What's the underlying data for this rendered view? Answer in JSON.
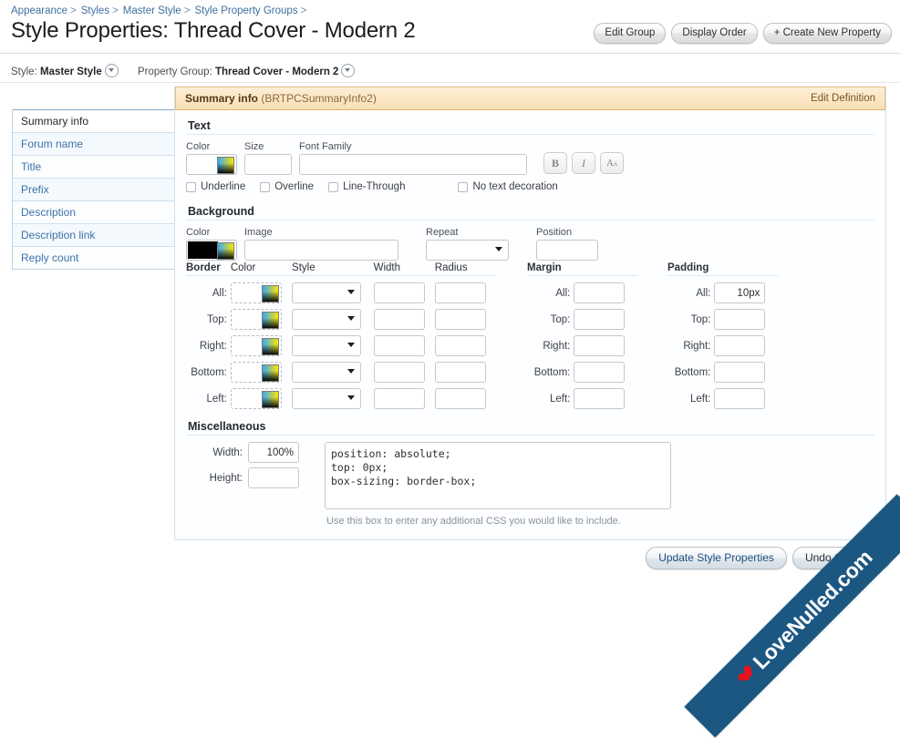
{
  "breadcrumb": [
    "Appearance",
    "Styles",
    "Master Style",
    "Style Property Groups"
  ],
  "page_title": "Style Properties: Thread Cover - Modern 2",
  "top_buttons": [
    {
      "label": "Edit Group",
      "name": "edit-group-button"
    },
    {
      "label": "Display Order",
      "name": "display-order-button"
    },
    {
      "label": "+ Create New Property",
      "name": "create-new-property-button"
    }
  ],
  "selector_row": {
    "style_label": "Style:",
    "style_value": "Master Style",
    "group_label": "Property Group:",
    "group_value": "Thread Cover - Modern 2"
  },
  "sidebar": {
    "items": [
      {
        "label": "Summary info",
        "active": true
      },
      {
        "label": "Forum name",
        "active": false
      },
      {
        "label": "Title",
        "active": false
      },
      {
        "label": "Prefix",
        "active": false
      },
      {
        "label": "Description",
        "active": false
      },
      {
        "label": "Description link",
        "active": false
      },
      {
        "label": "Reply count",
        "active": false
      }
    ]
  },
  "panel": {
    "name": "Summary info",
    "code": "(BRTPCSummaryInfo2)",
    "edit_link": "Edit Definition"
  },
  "text_section": {
    "title": "Text",
    "color_label": "Color",
    "color_value": "",
    "size_label": "Size",
    "size_value": "",
    "font_label": "Font Family",
    "font_value": "",
    "buttons": [
      {
        "glyph": "B",
        "name": "bold-button"
      },
      {
        "glyph": "I",
        "name": "italic-button"
      },
      {
        "glyph": "A",
        "name": "capitalize-button"
      }
    ],
    "checkboxes": [
      {
        "label": "Underline",
        "checked": false
      },
      {
        "label": "Overline",
        "checked": false
      },
      {
        "label": "Line-Through",
        "checked": false
      },
      {
        "label": "No text decoration",
        "checked": false
      }
    ]
  },
  "background_section": {
    "title": "Background",
    "color_label": "Color",
    "color_value": "#000000",
    "image_label": "Image",
    "image_value": "",
    "repeat_label": "Repeat",
    "repeat_value": "",
    "position_label": "Position",
    "position_value": ""
  },
  "box_section": {
    "border_header": "Border",
    "col_color": "Color",
    "col_style": "Style",
    "col_width": "Width",
    "col_radius": "Radius",
    "margin_header": "Margin",
    "padding_header": "Padding",
    "row_labels": [
      "All:",
      "Top:",
      "Right:",
      "Bottom:",
      "Left:"
    ],
    "border_rows": [
      {
        "color": "",
        "style": "",
        "width": "",
        "radius": ""
      },
      {
        "color": "",
        "style": "",
        "width": "",
        "radius": ""
      },
      {
        "color": "",
        "style": "",
        "width": "",
        "radius": ""
      },
      {
        "color": "",
        "style": "",
        "width": "",
        "radius": ""
      },
      {
        "color": "",
        "style": "",
        "width": "",
        "radius": ""
      }
    ],
    "margin_values": [
      "",
      "",
      "",
      "",
      ""
    ],
    "padding_values": [
      "10px",
      "",
      "",
      "",
      ""
    ]
  },
  "misc_section": {
    "title": "Miscellaneous",
    "width_label": "Width:",
    "width_value": "100%",
    "height_label": "Height:",
    "height_value": "",
    "css_value": "position: absolute;\ntop: 0px;\nbox-sizing: border-box;",
    "hint": "Use this box to enter any additional CSS you would like to include."
  },
  "bottom_buttons": [
    {
      "label": "Update Style Properties",
      "name": "update-style-properties-button"
    },
    {
      "label": "Undo Changes",
      "name": "undo-changes-button"
    }
  ],
  "watermark": {
    "text": "LoveNulled.com",
    "color": "#1c5782"
  }
}
